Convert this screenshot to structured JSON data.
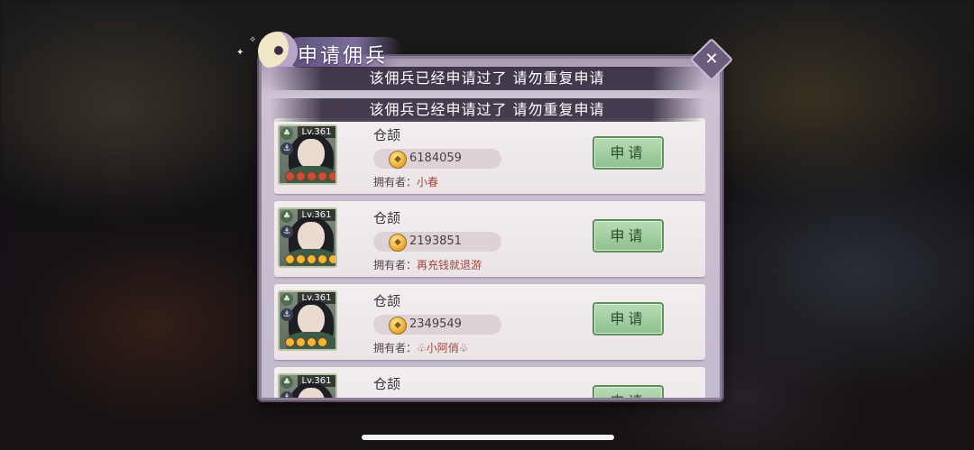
{
  "window": {
    "title": "申请佣兵"
  },
  "toasts": [
    "该佣兵已经申请过了 请勿重复申请",
    "该佣兵已经申请过了 请勿重复申请"
  ],
  "mercenaries": [
    {
      "level": "Lv.361",
      "name": "仓颉",
      "power": "6184059",
      "owner_label": "拥有者：",
      "owner": "小春",
      "apply_label": "申请",
      "star_color": "red"
    },
    {
      "level": "Lv.361",
      "name": "仓颉",
      "power": "2193851",
      "owner_label": "拥有者：",
      "owner": "再充钱就退游",
      "apply_label": "申请",
      "star_color": "gold"
    },
    {
      "level": "Lv.361",
      "name": "仓颉",
      "power": "2349549",
      "owner_label": "拥有者：",
      "owner": "♧小阿俏♧",
      "apply_label": "申请",
      "star_color": "gold"
    },
    {
      "level": "Lv.361",
      "name": "仓颉",
      "power": "",
      "owner_label": "",
      "owner": "",
      "apply_label": "申请",
      "star_color": "gold"
    }
  ],
  "colors": {
    "apply_button": "#8fc18e",
    "panel": "#cdc3d2",
    "owner_name": "#a0463f"
  },
  "icons": {
    "close": "close-icon",
    "coin": "coin-icon",
    "element": "leaf-element-icon",
    "type": "anchor-type-icon"
  }
}
